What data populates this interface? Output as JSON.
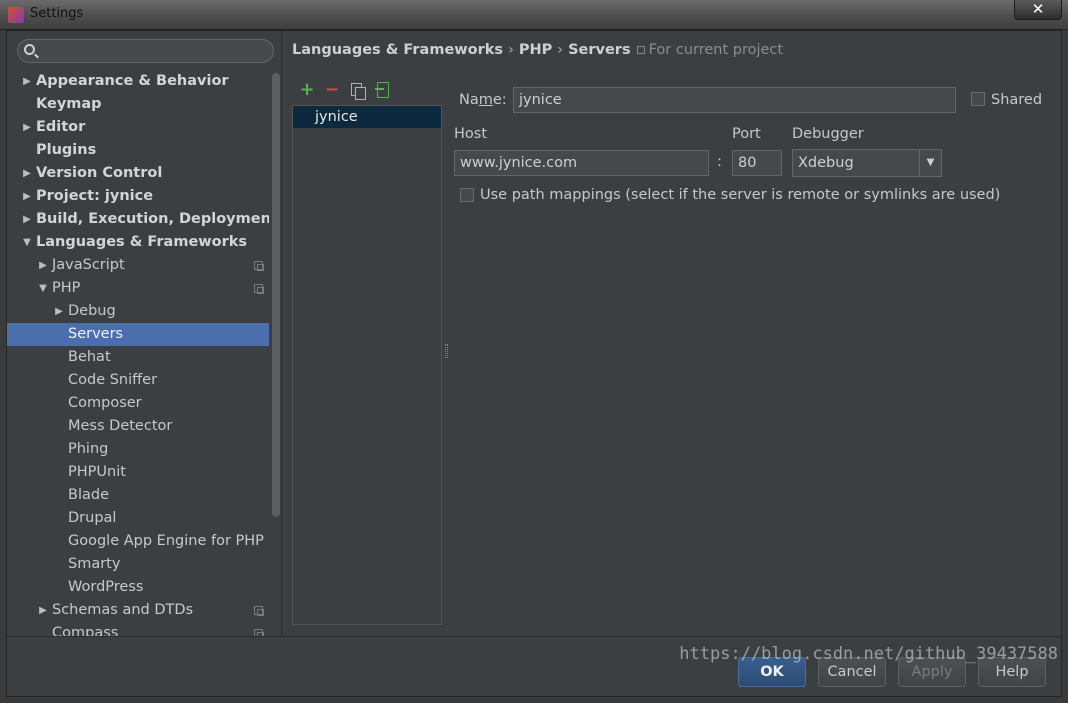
{
  "window": {
    "title": "Settings",
    "close_label": "✕"
  },
  "search": {
    "placeholder": ""
  },
  "sidebar": {
    "items": [
      {
        "label": "Appearance & Behavior",
        "level": 0,
        "bold": true,
        "arrow": "right"
      },
      {
        "label": "Keymap",
        "level": 0,
        "bold": true,
        "arrow": ""
      },
      {
        "label": "Editor",
        "level": 0,
        "bold": true,
        "arrow": "right"
      },
      {
        "label": "Plugins",
        "level": 0,
        "bold": true,
        "arrow": ""
      },
      {
        "label": "Version Control",
        "level": 0,
        "bold": true,
        "arrow": "right"
      },
      {
        "label": "Project: jynice",
        "level": 0,
        "bold": true,
        "arrow": "right"
      },
      {
        "label": "Build, Execution, Deployment",
        "level": 0,
        "bold": true,
        "arrow": "right"
      },
      {
        "label": "Languages & Frameworks",
        "level": 0,
        "bold": true,
        "arrow": "down"
      },
      {
        "label": "JavaScript",
        "level": 1,
        "bold": false,
        "arrow": "right",
        "project_icon": true
      },
      {
        "label": "PHP",
        "level": 1,
        "bold": false,
        "arrow": "down",
        "project_icon": true
      },
      {
        "label": "Debug",
        "level": 2,
        "bold": false,
        "arrow": "right"
      },
      {
        "label": "Servers",
        "level": 2,
        "bold": false,
        "arrow": "",
        "selected": true
      },
      {
        "label": "Behat",
        "level": 2,
        "bold": false,
        "arrow": ""
      },
      {
        "label": "Code Sniffer",
        "level": 2,
        "bold": false,
        "arrow": ""
      },
      {
        "label": "Composer",
        "level": 2,
        "bold": false,
        "arrow": ""
      },
      {
        "label": "Mess Detector",
        "level": 2,
        "bold": false,
        "arrow": ""
      },
      {
        "label": "Phing",
        "level": 2,
        "bold": false,
        "arrow": ""
      },
      {
        "label": "PHPUnit",
        "level": 2,
        "bold": false,
        "arrow": ""
      },
      {
        "label": "Blade",
        "level": 2,
        "bold": false,
        "arrow": ""
      },
      {
        "label": "Drupal",
        "level": 2,
        "bold": false,
        "arrow": ""
      },
      {
        "label": "Google App Engine for PHP",
        "level": 2,
        "bold": false,
        "arrow": ""
      },
      {
        "label": "Smarty",
        "level": 2,
        "bold": false,
        "arrow": ""
      },
      {
        "label": "WordPress",
        "level": 2,
        "bold": false,
        "arrow": ""
      },
      {
        "label": "Schemas and DTDs",
        "level": 1,
        "bold": false,
        "arrow": "right",
        "project_icon": true
      },
      {
        "label": "Compass",
        "level": 1,
        "bold": false,
        "arrow": "",
        "project_icon": true
      }
    ]
  },
  "breadcrumb": {
    "part1": "Languages & Frameworks",
    "sep": "›",
    "part2": "PHP",
    "part3": "Servers",
    "scope": "For current project"
  },
  "toolbar": {
    "add": "+",
    "remove": "−"
  },
  "servers": {
    "items": [
      "jynice"
    ]
  },
  "form": {
    "name_label_pre": "Na",
    "name_label_u": "m",
    "name_label_post": "e:",
    "name_value": "jynice",
    "shared_label": "Shared",
    "host_label": "Host",
    "host_value": "www.jynice.com",
    "colon": ":",
    "port_label": "Port",
    "port_value": "80",
    "debugger_label": "Debugger",
    "debugger_value": "Xdebug",
    "path_mappings_label": "Use path mappings (select if the server is remote or symlinks are used)"
  },
  "buttons": {
    "ok": "OK",
    "cancel": "Cancel",
    "apply": "Apply",
    "help": "Help"
  },
  "watermark": "https://blog.csdn.net/github_39437588"
}
